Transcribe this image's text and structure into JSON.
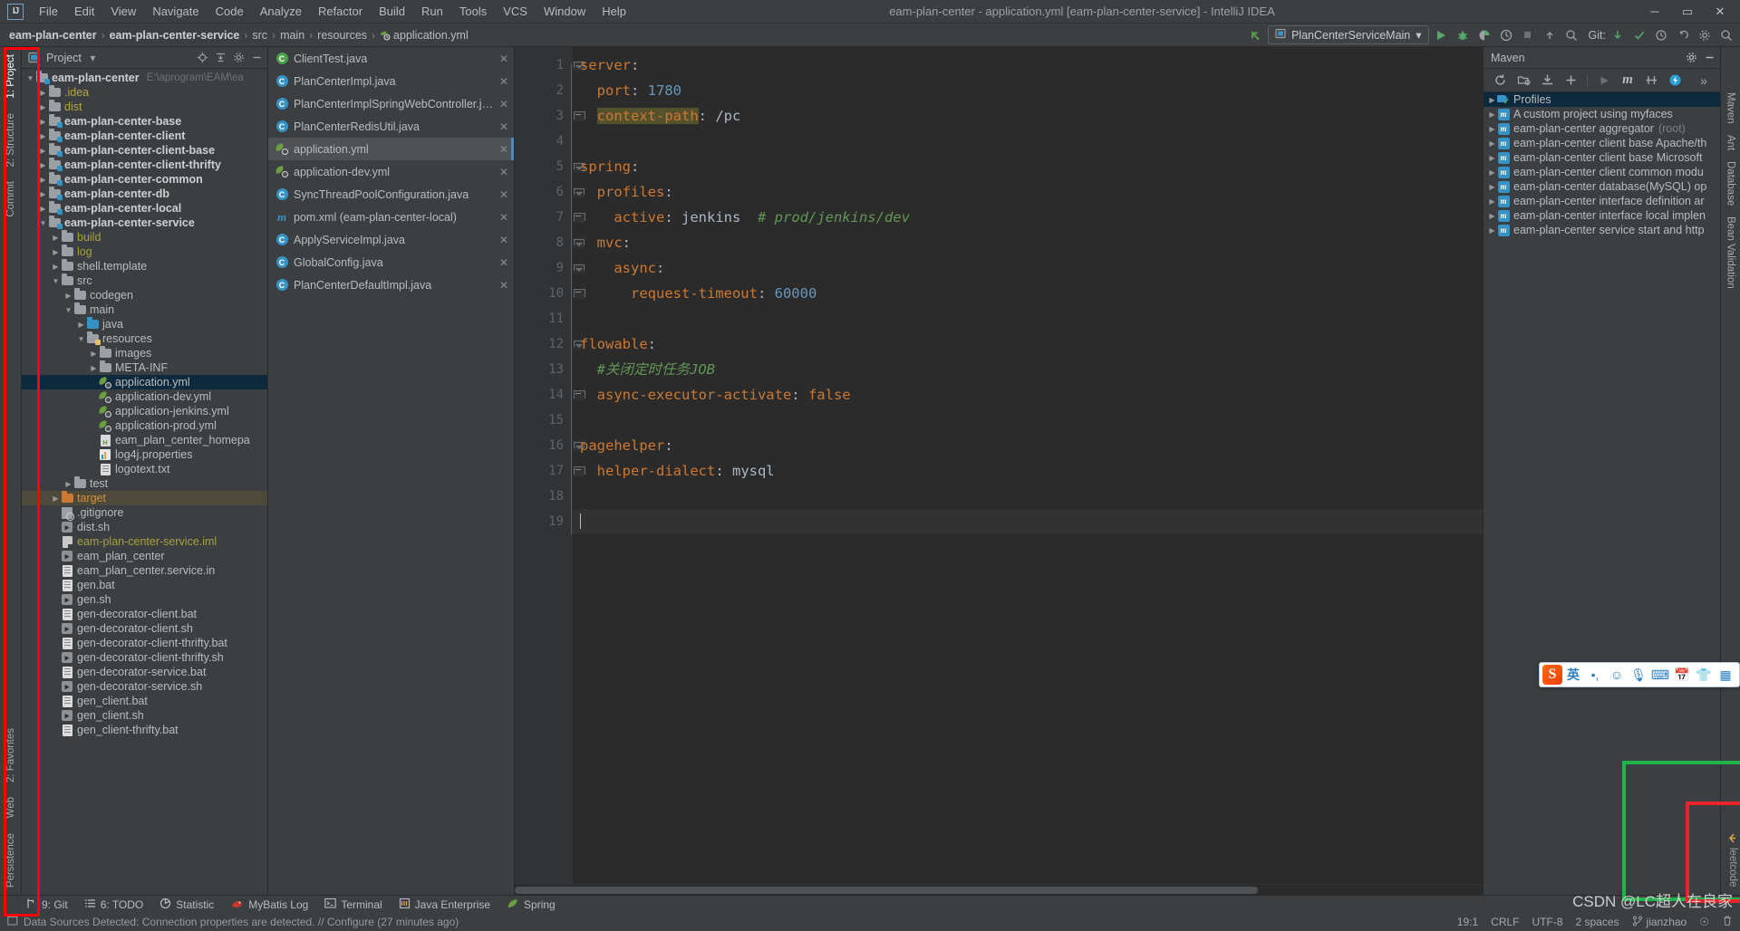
{
  "window": {
    "title": "eam-plan-center - application.yml [eam-plan-center-service] - IntelliJ IDEA",
    "minimize": "─",
    "maximize": "▭",
    "close": "✕"
  },
  "menu": {
    "items": [
      "File",
      "Edit",
      "View",
      "Navigate",
      "Code",
      "Analyze",
      "Refactor",
      "Build",
      "Run",
      "Tools",
      "VCS",
      "Window",
      "Help"
    ]
  },
  "breadcrumb": {
    "items": [
      "eam-plan-center",
      "eam-plan-center-service",
      "src",
      "main",
      "resources",
      "application.yml"
    ],
    "separator": "›"
  },
  "toolbar": {
    "run_config": "PlanCenterServiceMain",
    "dropdown_caret": "▾",
    "git_label": "Git:",
    "run_icon": "▶",
    "debug_icon": "debug-bug-icon",
    "coverage_icon": "coverage-icon",
    "profiler_icon": "profiler-icon",
    "stop_icon": "■",
    "back_arrow": "↖"
  },
  "project_panel": {
    "title": "Project",
    "dropdown": "▾",
    "icons": [
      "locate-icon",
      "collapse-all-icon",
      "gear-icon",
      "hide-icon"
    ],
    "root_path_hint": "E:\\aprogram\\EAM\\ea",
    "tree": [
      {
        "label": "eam-plan-center",
        "indent": 0,
        "arrow": "down",
        "icon": "module-folder",
        "style": "bold",
        "hint": "E:\\aprogram\\EAM\\ea"
      },
      {
        "label": ".idea",
        "indent": 1,
        "arrow": "right",
        "icon": "folder",
        "style": "yellow"
      },
      {
        "label": "dist",
        "indent": 1,
        "arrow": "right",
        "icon": "folder",
        "style": "yellow"
      },
      {
        "label": "eam-plan-center-base",
        "indent": 1,
        "arrow": "right",
        "icon": "module-folder",
        "style": "bold"
      },
      {
        "label": "eam-plan-center-client",
        "indent": 1,
        "arrow": "right",
        "icon": "module-folder",
        "style": "bold"
      },
      {
        "label": "eam-plan-center-client-base",
        "indent": 1,
        "arrow": "right",
        "icon": "module-folder",
        "style": "bold"
      },
      {
        "label": "eam-plan-center-client-thrifty",
        "indent": 1,
        "arrow": "right",
        "icon": "module-folder",
        "style": "bold"
      },
      {
        "label": "eam-plan-center-common",
        "indent": 1,
        "arrow": "right",
        "icon": "module-folder",
        "style": "bold"
      },
      {
        "label": "eam-plan-center-db",
        "indent": 1,
        "arrow": "right",
        "icon": "module-folder",
        "style": "bold"
      },
      {
        "label": "eam-plan-center-local",
        "indent": 1,
        "arrow": "right",
        "icon": "module-folder",
        "style": "bold"
      },
      {
        "label": "eam-plan-center-service",
        "indent": 1,
        "arrow": "down",
        "icon": "module-folder",
        "style": "bold"
      },
      {
        "label": "build",
        "indent": 2,
        "arrow": "right",
        "icon": "folder",
        "style": "olive"
      },
      {
        "label": "log",
        "indent": 2,
        "arrow": "right",
        "icon": "folder",
        "style": "olive"
      },
      {
        "label": "shell.template",
        "indent": 2,
        "arrow": "right",
        "icon": "folder",
        "style": ""
      },
      {
        "label": "src",
        "indent": 2,
        "arrow": "down",
        "icon": "folder",
        "style": ""
      },
      {
        "label": "codegen",
        "indent": 3,
        "arrow": "right",
        "icon": "folder",
        "style": ""
      },
      {
        "label": "main",
        "indent": 3,
        "arrow": "down",
        "icon": "folder",
        "style": ""
      },
      {
        "label": "java",
        "indent": 4,
        "arrow": "right",
        "icon": "source-folder",
        "style": ""
      },
      {
        "label": "resources",
        "indent": 4,
        "arrow": "down",
        "icon": "resource-folder",
        "style": ""
      },
      {
        "label": "images",
        "indent": 5,
        "arrow": "right",
        "icon": "folder",
        "style": ""
      },
      {
        "label": "META-INF",
        "indent": 5,
        "arrow": "right",
        "icon": "folder",
        "style": ""
      },
      {
        "label": "application.yml",
        "indent": 5,
        "arrow": "none",
        "icon": "yml",
        "style": "",
        "selected": true
      },
      {
        "label": "application-dev.yml",
        "indent": 5,
        "arrow": "none",
        "icon": "yml",
        "style": ""
      },
      {
        "label": "application-jenkins.yml",
        "indent": 5,
        "arrow": "none",
        "icon": "yml",
        "style": ""
      },
      {
        "label": "application-prod.yml",
        "indent": 5,
        "arrow": "none",
        "icon": "yml",
        "style": ""
      },
      {
        "label": "eam_plan_center_homepa",
        "indent": 5,
        "arrow": "none",
        "icon": "html",
        "style": ""
      },
      {
        "label": "log4j.properties",
        "indent": 5,
        "arrow": "none",
        "icon": "properties",
        "style": ""
      },
      {
        "label": "logotext.txt",
        "indent": 5,
        "arrow": "none",
        "icon": "txt",
        "style": ""
      },
      {
        "label": "test",
        "indent": 3,
        "arrow": "right",
        "icon": "folder",
        "style": ""
      },
      {
        "label": "target",
        "indent": 2,
        "arrow": "right",
        "icon": "folder-orange",
        "style": "orange",
        "highlight": true
      },
      {
        "label": ".gitignore",
        "indent": 2,
        "arrow": "none",
        "icon": "gitignore",
        "style": ""
      },
      {
        "label": "dist.sh",
        "indent": 2,
        "arrow": "none",
        "icon": "sh",
        "style": ""
      },
      {
        "label": "eam-plan-center-service.iml",
        "indent": 2,
        "arrow": "none",
        "icon": "iml",
        "style": "olive"
      },
      {
        "label": "eam_plan_center",
        "indent": 2,
        "arrow": "none",
        "icon": "sh",
        "style": ""
      },
      {
        "label": "eam_plan_center.service.in",
        "indent": 2,
        "arrow": "none",
        "icon": "txt",
        "style": ""
      },
      {
        "label": "gen.bat",
        "indent": 2,
        "arrow": "none",
        "icon": "bat",
        "style": ""
      },
      {
        "label": "gen.sh",
        "indent": 2,
        "arrow": "none",
        "icon": "sh",
        "style": ""
      },
      {
        "label": "gen-decorator-client.bat",
        "indent": 2,
        "arrow": "none",
        "icon": "bat",
        "style": ""
      },
      {
        "label": "gen-decorator-client.sh",
        "indent": 2,
        "arrow": "none",
        "icon": "sh",
        "style": ""
      },
      {
        "label": "gen-decorator-client-thrifty.bat",
        "indent": 2,
        "arrow": "none",
        "icon": "bat",
        "style": ""
      },
      {
        "label": "gen-decorator-client-thrifty.sh",
        "indent": 2,
        "arrow": "none",
        "icon": "sh",
        "style": ""
      },
      {
        "label": "gen-decorator-service.bat",
        "indent": 2,
        "arrow": "none",
        "icon": "bat",
        "style": ""
      },
      {
        "label": "gen-decorator-service.sh",
        "indent": 2,
        "arrow": "none",
        "icon": "sh",
        "style": ""
      },
      {
        "label": "gen_client.bat",
        "indent": 2,
        "arrow": "none",
        "icon": "bat",
        "style": ""
      },
      {
        "label": "gen_client.sh",
        "indent": 2,
        "arrow": "none",
        "icon": "sh",
        "style": ""
      },
      {
        "label": "gen_client-thrifty.bat",
        "indent": 2,
        "arrow": "none",
        "icon": "bat",
        "style": ""
      }
    ]
  },
  "left_strip": {
    "tabs": [
      "1: Project",
      "2: Structure",
      "Commit"
    ]
  },
  "left_strip_bottom": {
    "tabs": [
      "2: Favorites",
      "Web",
      "Persistence"
    ]
  },
  "right_strip": {
    "tabs": [
      "Maven",
      "Ant",
      "Database",
      "Bean Validation",
      "leetcode"
    ]
  },
  "editor_tabs": {
    "items": [
      {
        "label": "ClientTest.java",
        "icon": "java-test",
        "active": false
      },
      {
        "label": "PlanCenterImpl.java",
        "icon": "java",
        "active": false
      },
      {
        "label": "PlanCenterImplSpringWebController.java",
        "icon": "java",
        "active": false
      },
      {
        "label": "PlanCenterRedisUtil.java",
        "icon": "java",
        "active": false
      },
      {
        "label": "application.yml",
        "icon": "yml",
        "active": true
      },
      {
        "label": "application-dev.yml",
        "icon": "yml",
        "active": false
      },
      {
        "label": "SyncThreadPoolConfiguration.java",
        "icon": "java",
        "active": false
      },
      {
        "label": "pom.xml (eam-plan-center-local)",
        "icon": "maven",
        "active": false
      },
      {
        "label": "ApplyServiceImpl.java",
        "icon": "java",
        "active": false
      },
      {
        "label": "GlobalConfig.java",
        "icon": "java",
        "active": false
      },
      {
        "label": "PlanCenterDefaultImpl.java",
        "icon": "java",
        "active": false
      }
    ],
    "close_glyph": "✕"
  },
  "editor": {
    "filename": "application.yml",
    "lines": [
      {
        "n": 1,
        "fold": "down",
        "tokens": [
          {
            "t": "server",
            "c": "k"
          },
          {
            "t": ":",
            "c": "p"
          }
        ]
      },
      {
        "n": 2,
        "fold": "",
        "tokens": [
          {
            "t": "  port",
            "c": "k"
          },
          {
            "t": ": ",
            "c": "p"
          },
          {
            "t": "1780",
            "c": "n"
          }
        ]
      },
      {
        "n": 3,
        "fold": "end",
        "tokens": [
          {
            "t": "  ",
            "c": "p"
          },
          {
            "t": "context-path",
            "c": "k hl"
          },
          {
            "t": ": ",
            "c": "p"
          },
          {
            "t": "/pc",
            "c": "s"
          }
        ]
      },
      {
        "n": 4,
        "fold": "",
        "tokens": []
      },
      {
        "n": 5,
        "fold": "down",
        "tokens": [
          {
            "t": "spring",
            "c": "k"
          },
          {
            "t": ":",
            "c": "p"
          }
        ]
      },
      {
        "n": 6,
        "fold": "down",
        "tokens": [
          {
            "t": "  profiles",
            "c": "k"
          },
          {
            "t": ":",
            "c": "p"
          }
        ]
      },
      {
        "n": 7,
        "fold": "end",
        "tokens": [
          {
            "t": "    active",
            "c": "k"
          },
          {
            "t": ": ",
            "c": "p"
          },
          {
            "t": "jenkins",
            "c": "s"
          },
          {
            "t": "  # prod/jenkins/dev",
            "c": "cm"
          }
        ]
      },
      {
        "n": 8,
        "fold": "down",
        "tokens": [
          {
            "t": "  mvc",
            "c": "k"
          },
          {
            "t": ":",
            "c": "p"
          }
        ]
      },
      {
        "n": 9,
        "fold": "down",
        "tokens": [
          {
            "t": "    async",
            "c": "k"
          },
          {
            "t": ":",
            "c": "p"
          }
        ]
      },
      {
        "n": 10,
        "fold": "end",
        "tokens": [
          {
            "t": "      request-timeout",
            "c": "k"
          },
          {
            "t": ": ",
            "c": "p"
          },
          {
            "t": "60000",
            "c": "n"
          }
        ]
      },
      {
        "n": 11,
        "fold": "",
        "tokens": []
      },
      {
        "n": 12,
        "fold": "down",
        "tokens": [
          {
            "t": "flowable",
            "c": "k"
          },
          {
            "t": ":",
            "c": "p"
          }
        ]
      },
      {
        "n": 13,
        "fold": "",
        "tokens": [
          {
            "t": "  #关闭定时任务JOB",
            "c": "cm"
          }
        ]
      },
      {
        "n": 14,
        "fold": "end",
        "tokens": [
          {
            "t": "  async-executor-activate",
            "c": "k"
          },
          {
            "t": ": ",
            "c": "p"
          },
          {
            "t": "false",
            "c": "k"
          }
        ]
      },
      {
        "n": 15,
        "fold": "",
        "tokens": []
      },
      {
        "n": 16,
        "fold": "down",
        "tokens": [
          {
            "t": "pagehelper",
            "c": "k"
          },
          {
            "t": ":",
            "c": "p"
          }
        ]
      },
      {
        "n": 17,
        "fold": "end",
        "tokens": [
          {
            "t": "  helper-dialect",
            "c": "k"
          },
          {
            "t": ": ",
            "c": "p"
          },
          {
            "t": "mysql",
            "c": "s"
          }
        ]
      },
      {
        "n": 18,
        "fold": "",
        "tokens": []
      },
      {
        "n": 19,
        "fold": "",
        "tokens": [],
        "current": true,
        "caret": true
      }
    ]
  },
  "maven_panel": {
    "title": "Maven",
    "toolbar_icons": [
      "reload-icon",
      "generate-sources-icon",
      "download-sources-icon",
      "add-icon",
      "run-icon",
      "maven-m-icon",
      "toggle-skip-tests-icon",
      "execute-goal-icon",
      "more-icon"
    ],
    "gear_icon": "gear-icon",
    "hide_icon": "hide-icon",
    "more_glyph": "»",
    "tree": [
      {
        "label": "Profiles",
        "icon": "profiles",
        "selected": true
      },
      {
        "label": "A custom project using myfaces",
        "icon": "maven-m"
      },
      {
        "label": "eam-plan-center aggregator",
        "suffix": "(root)",
        "icon": "maven-m"
      },
      {
        "label": "eam-plan-center client base Apache/th",
        "icon": "maven-m"
      },
      {
        "label": "eam-plan-center client base Microsoft",
        "icon": "maven-m"
      },
      {
        "label": "eam-plan-center client common modu",
        "icon": "maven-m"
      },
      {
        "label": "eam-plan-center database(MySQL) op",
        "icon": "maven-m"
      },
      {
        "label": "eam-plan-center interface definition ar",
        "icon": "maven-m"
      },
      {
        "label": "eam-plan-center interface local implen",
        "icon": "maven-m"
      },
      {
        "label": "eam-plan-center service start and http",
        "icon": "maven-m"
      }
    ]
  },
  "tool_windows": {
    "items": [
      {
        "label": "9: Git",
        "icon": "git-branch-icon",
        "underline": "9"
      },
      {
        "label": "6: TODO",
        "icon": "todo-list-icon",
        "underline": "6"
      },
      {
        "label": "Statistic",
        "icon": "statistic-pie-icon"
      },
      {
        "label": "MyBatis Log",
        "icon": "mybatis-bird-icon"
      },
      {
        "label": "Terminal",
        "icon": "terminal-icon"
      },
      {
        "label": "Java Enterprise",
        "icon": "java-enterprise-icon"
      },
      {
        "label": "Spring",
        "icon": "spring-leaf-icon"
      }
    ]
  },
  "status_bar": {
    "message": "Data Sources Detected: Connection properties are detected. // Configure (27 minutes ago)",
    "caret_position": "19:1",
    "line_separator": "CRLF",
    "encoding": "UTF-8",
    "indent": "2 spaces",
    "branch": "jianzhao",
    "lock_state": "☉",
    "memory": "",
    "git_icon": "git-branch-icon",
    "lock_icon": "lock-icon",
    "trash_icon": "trash-icon"
  },
  "sogou_toolbar": {
    "logo": "S",
    "items": [
      "英",
      "•,",
      "☺",
      "🎙",
      "⌨",
      "📅",
      "👕",
      "▦"
    ]
  },
  "watermark": {
    "text": "CSDN @LC超人在良家"
  },
  "annotations": {
    "red_box_label": "project-tree-highlight",
    "green_box_label": "bottom-right-green-highlight",
    "red_box2_label": "bottom-right-red-highlight"
  },
  "colors": {
    "accent_blue": "#3592c4",
    "selection_blue": "#0d293e",
    "keyword_orange": "#cc7832",
    "number_blue": "#6897bb",
    "comment_green": "#629755",
    "highlight_yellow": "#55512d",
    "annotation_red": "#ff0000",
    "annotation_green": "#21b34a",
    "bg_panel": "#3c3f41",
    "bg_editor": "#2b2b2b"
  }
}
